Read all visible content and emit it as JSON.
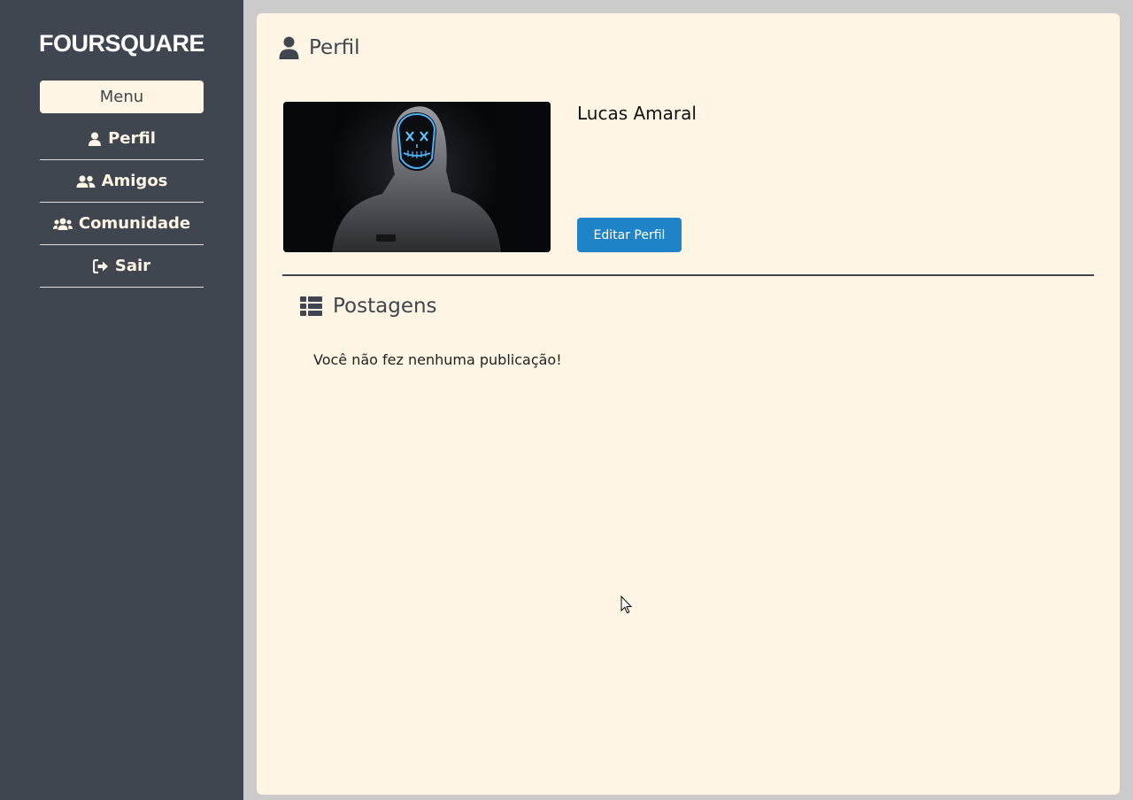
{
  "sidebar": {
    "logo": "FOURSQUARE",
    "menu_label": "Menu",
    "items": [
      {
        "label": "Perfil",
        "icon": "user-icon"
      },
      {
        "label": "Amigos",
        "icon": "user-friends-icon"
      },
      {
        "label": "Comunidade",
        "icon": "users-icon"
      },
      {
        "label": "Sair",
        "icon": "sign-out-icon"
      }
    ]
  },
  "main": {
    "page_title": "Perfil",
    "page_icon": "user-icon",
    "profile": {
      "name": "Lucas Amaral",
      "edit_button": "Editar Perfil",
      "photo_icon": "hooded-figure-neon-mask-photo"
    },
    "posts": {
      "title": "Postagens",
      "icon": "list-icon",
      "empty_message": "Você não fez nenhuma publicação!"
    }
  },
  "colors": {
    "sidebar_bg": "#3f464f",
    "content_bg": "#fff5e4",
    "accent": "#1f84c7",
    "page_bg": "#cbcbcb"
  }
}
